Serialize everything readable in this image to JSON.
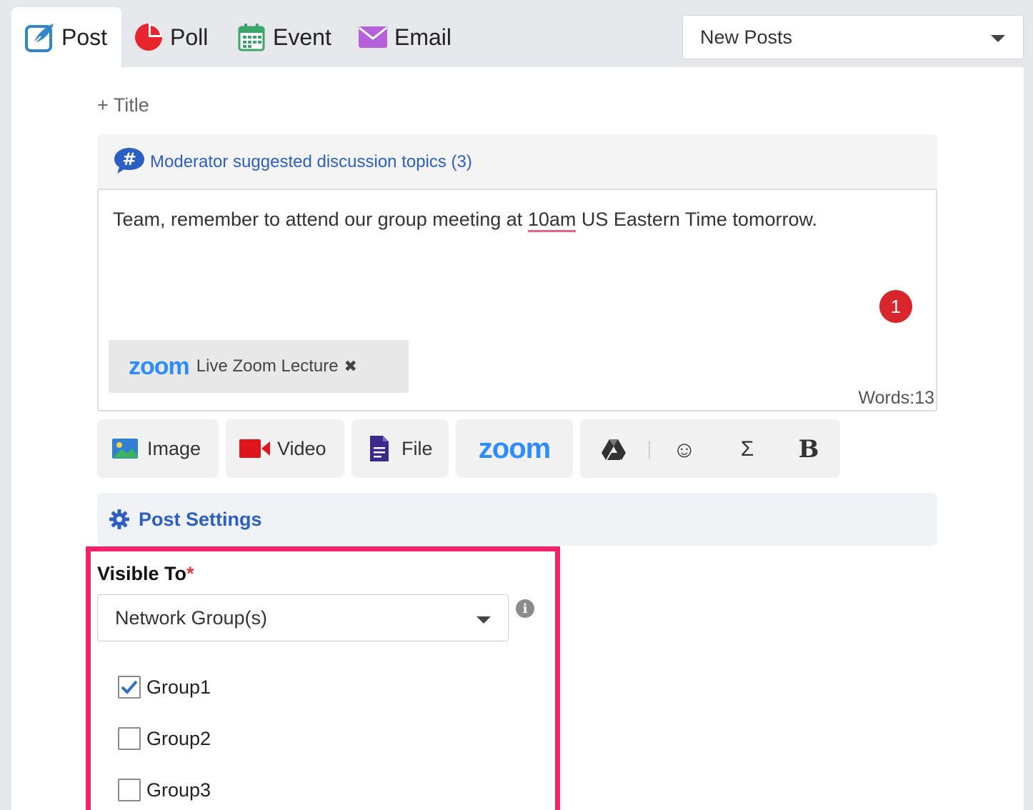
{
  "tabs": [
    {
      "label": "Post",
      "icon": "post-quill-icon"
    },
    {
      "label": "Poll",
      "icon": "pie-chart-icon"
    },
    {
      "label": "Event",
      "icon": "calendar-icon"
    },
    {
      "label": "Email",
      "icon": "envelope-icon"
    }
  ],
  "feed_filter": {
    "selected": "New Posts"
  },
  "composer": {
    "add_title": "+ Title",
    "topics_label": "Moderator suggested discussion topics (3)",
    "text_before": "Team, remember to attend our group meeting at ",
    "text_flagged": "10am",
    "text_after": " US Eastern Time tomorrow.",
    "badge_count": "1",
    "attachment": {
      "logo": "zoom",
      "name": "Live Zoom Lecture",
      "remove": "✖"
    },
    "word_count": "Words:13"
  },
  "toolbar": {
    "image_label": "Image",
    "video_label": "Video",
    "file_label": "File",
    "zoom_label": "zoom",
    "emoji": "☺",
    "sigma": "Σ",
    "bold": "B"
  },
  "post_settings": {
    "label": "Post Settings"
  },
  "visibility": {
    "label": "Visible To",
    "required": "*",
    "selected": "Network Group(s)",
    "info": "i",
    "groups": [
      {
        "name": "Group1",
        "checked": true
      },
      {
        "name": "Group2",
        "checked": false
      },
      {
        "name": "Group3",
        "checked": false
      }
    ]
  },
  "colors": {
    "accent": "#2c5fc4",
    "highlight": "#f7206a",
    "zoom": "#2d8cff",
    "badge": "#d9252c"
  }
}
